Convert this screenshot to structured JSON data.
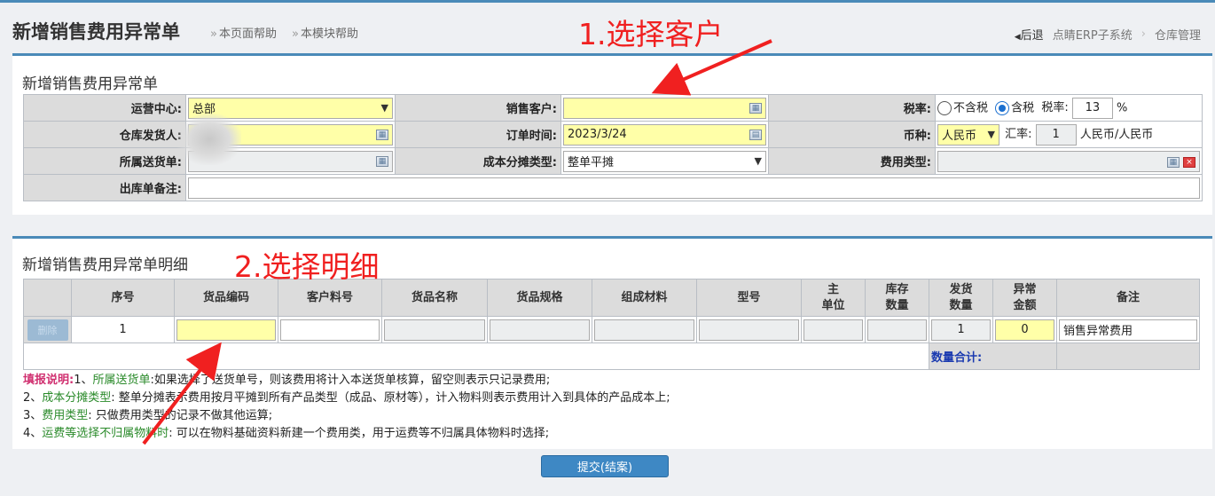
{
  "header": {
    "title": "新增销售费用异常单",
    "help_page": "本页面帮助",
    "help_module": "本模块帮助",
    "back": "后退",
    "crumb1": "点睛ERP子系统",
    "crumb2": "仓库管理"
  },
  "annotations": {
    "step1": "1.选择客户",
    "step2": "2.选择明细"
  },
  "form": {
    "panel_title": "新增销售费用异常单",
    "ops_center_label": "运营中心:",
    "ops_center_value": "总部",
    "customer_label": "销售客户:",
    "customer_value": "",
    "tax_label": "税率:",
    "tax_excl": "不含税",
    "tax_incl": "含税",
    "tax_rate_label": "税率:",
    "tax_rate_value": "13",
    "percent": "%",
    "shipper_label": "仓库发货人:",
    "order_time_label": "订单时间:",
    "order_time_value": "2023/3/24",
    "currency_label": "币种:",
    "currency_value": "人民币",
    "rate_label": "汇率:",
    "rate_value": "1",
    "rate_unit": "人民币/人民币",
    "delivery_label": "所属送货单:",
    "cost_type_label": "成本分摊类型:",
    "cost_type_value": "整单平摊",
    "fee_type_label": "费用类型:",
    "remark_label": "出库单备注:"
  },
  "detail": {
    "panel_title": "新增销售费用异常单明细",
    "columns": [
      "序号",
      "货品编码",
      "客户料号",
      "货品名称",
      "货品规格",
      "组成材料",
      "型号",
      "主\n单位",
      "库存\n数量",
      "发货\n数量",
      "异常\n金额",
      "备注"
    ],
    "row": {
      "delete": "删除",
      "seq": "1",
      "ship_qty": "1",
      "amount": "0",
      "remark": "销售异常费用"
    },
    "total_label": "数量合计:"
  },
  "notes": {
    "title": "填报说明:",
    "n1_prefix": "1、",
    "n1_key": "所属送货单",
    "n1_text": ":如果选择了送货单号，则该费用将计入本送货单核算，留空则表示只记录费用;",
    "n2_prefix": "2、",
    "n2_key": "成本分摊类型",
    "n2_text": ": 整单分摊表示费用按月平摊到所有产品类型（成品、原材等），计入物料则表示费用计入到具体的产品成本上;",
    "n3_prefix": "3、",
    "n3_key": "费用类型",
    "n3_text": ": 只做费用类型的记录不做其他运算;",
    "n4_prefix": "4、",
    "n4_key": "运费等选择不归属物料时",
    "n4_text": ": 可以在物料基础资料新建一个费用类，用于运费等不归属具体物料时选择;"
  },
  "submit_label": "提交(结案)"
}
